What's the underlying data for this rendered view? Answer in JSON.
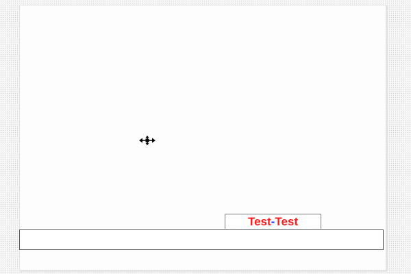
{
  "canvas": {
    "cursor_icon": "move-cursor-icon"
  },
  "text_frame": {
    "word_left": "Test",
    "separator": "-",
    "word_right": "Test",
    "colors": {
      "word": "#ff1a1a",
      "separator": "#1a2fff"
    }
  },
  "input_bar": {
    "value": ""
  }
}
